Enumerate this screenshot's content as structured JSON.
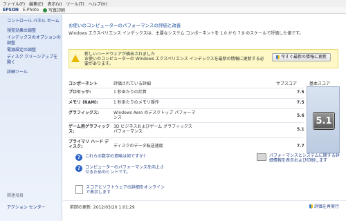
{
  "menubar": [
    "ファイル(F)",
    "編集(E)",
    "表示(V)",
    "ツール(T)",
    "ヘルプ(H)"
  ],
  "toolbar": {
    "brand": "EPSON",
    "photo": "E-Photo",
    "print": "写真印刷"
  },
  "sidebar": {
    "home": "コントロール パネル ホーム",
    "links": [
      "視覚効果の調整",
      "インデックスのオプションの調整",
      "電源設定の調整",
      "ディスク クリーンアップを開く",
      "詳細ツール"
    ],
    "related_header": "関連項目",
    "action_center": "アクション センター"
  },
  "main": {
    "title": "お使いのコンピューターのパフォーマンスの評価と改善",
    "intro": "Windows エクスペリエンス インデックスは、主要なシステム コンポーネントを 1.0 から 7.9 のスケールで評価した値です。",
    "warning": "新しいハードウェアが検出されました\nお使いのコンピューターの Windows エクスペリエンス インデックスを最新の情報に更新する必要があります。",
    "refresh_button": "今すぐ最新の情報に更新",
    "columns": {
      "component": "コンポーネント",
      "details": "評価されている詳細",
      "subscore": "サブスコア",
      "basescore": "基本スコア"
    },
    "rows": [
      {
        "component": "プロセッサ:",
        "detail": "1 秒あたりの計算",
        "score": "7.5"
      },
      {
        "component": "メモリ (RAM):",
        "detail": "1 秒あたりのメモリ操作",
        "score": "7.5"
      },
      {
        "component": "グラフィックス:",
        "detail": "Windows Aero のデスクトップ パフォーマンス",
        "score": "5.6"
      },
      {
        "component": "ゲーム用グラフィックス:",
        "detail": "3D ビジネスおよびゲーム グラフィックス パフォーマンス",
        "score": "5.1"
      },
      {
        "component": "プライマリ ハード ディスク:",
        "detail": "ディスクのデータ転送速度",
        "score": "7.7"
      }
    ],
    "base_score": "5.1",
    "link1": "これらの数字の意味は何ですか?",
    "link2": "コンピューターのパフォーマンスを向上させるためのヒントです。",
    "link3": "パフォーマンスとシステムに関する詳細情報を表示および印刷します",
    "link4": "スコアとソフトウェアの詳細をオンラインで表示します",
    "last_updated": "前回の更新: 2012/03/20 1:01:29",
    "rerun": "評価を再実行"
  }
}
